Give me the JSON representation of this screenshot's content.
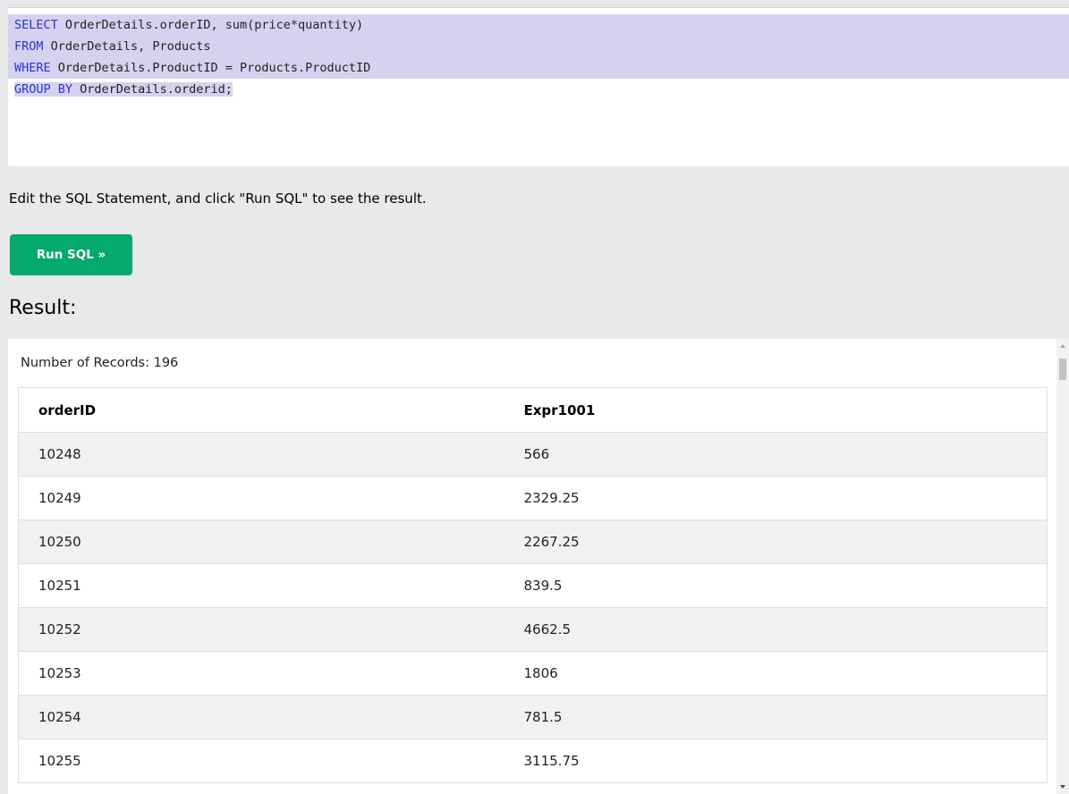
{
  "editor": {
    "lines": [
      {
        "keyword": "SELECT",
        "rest": " OrderDetails.orderID, sum(price*quantity)"
      },
      {
        "keyword": "FROM",
        "rest": " OrderDetails, Products"
      },
      {
        "keyword": "WHERE",
        "rest": " OrderDetails.ProductID = Products.ProductID"
      },
      {
        "keyword": "GROUP BY",
        "rest": " OrderDetails.orderid;"
      }
    ],
    "keyword_color": "#2e32d6",
    "selection_color": "#d4d2ef"
  },
  "instruction": "Edit the SQL Statement, and click \"Run SQL\" to see the result.",
  "run_button": {
    "label": "Run SQL »",
    "color": "#04aa6d"
  },
  "result": {
    "heading": "Result:",
    "records_label": "Number of Records: 196",
    "columns": [
      "orderID",
      "Expr1001"
    ],
    "rows": [
      [
        "10248",
        "566"
      ],
      [
        "10249",
        "2329.25"
      ],
      [
        "10250",
        "2267.25"
      ],
      [
        "10251",
        "839.5"
      ],
      [
        "10252",
        "4662.5"
      ],
      [
        "10253",
        "1806"
      ],
      [
        "10254",
        "781.5"
      ],
      [
        "10255",
        "3115.75"
      ]
    ]
  }
}
